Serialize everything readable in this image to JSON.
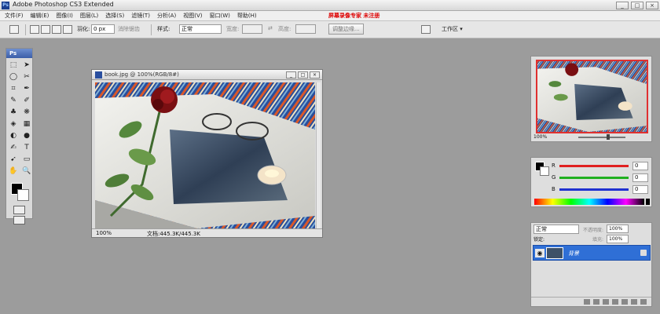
{
  "titlebar": {
    "app_icon": "Ps",
    "title": "Adobe Photoshop CS3 Extended",
    "min": "_",
    "max": "□",
    "close": "×"
  },
  "menubar": {
    "items": [
      "文件(F)",
      "编辑(E)",
      "图像(I)",
      "图层(L)",
      "选择(S)",
      "滤镜(T)",
      "分析(A)",
      "视图(V)",
      "窗口(W)",
      "帮助(H)"
    ],
    "watermark": "屏幕录像专家 未注册"
  },
  "options": {
    "feather_label": "羽化:",
    "feather_value": "0 px",
    "antialias": "消除锯齿",
    "style_label": "样式:",
    "style_value": "正常",
    "width_label": "宽度:",
    "height_label": "高度:",
    "refine_edge": "调整边缘...",
    "workspace": "工作区 ▾"
  },
  "toolbox": {
    "header": "Ps",
    "tools": [
      "⬚",
      "➤",
      "◯",
      "✂",
      "⌗",
      "✒",
      "✎",
      "✐",
      "♣",
      "❋",
      "◈",
      "▦",
      "◐",
      "●",
      "✍",
      "T",
      "➹",
      "▭",
      "✋",
      "🔍"
    ]
  },
  "document": {
    "title": "book.jpg @ 100%(RGB/8#)",
    "zoom": "100%",
    "doc_info": "文档:445.3K/445.3K"
  },
  "navigator": {
    "zoom": "100%"
  },
  "color_panel": {
    "rows": [
      {
        "label": "R",
        "value": "0",
        "color": "#e02020"
      },
      {
        "label": "G",
        "value": "0",
        "color": "#20b020"
      },
      {
        "label": "B",
        "value": "0",
        "color": "#2030d0"
      }
    ]
  },
  "layers": {
    "blend_mode": "正常",
    "opacity_label": "不透明度:",
    "opacity_value": "100%",
    "lock_label": "锁定:",
    "fill_label": "填充:",
    "fill_value": "100%",
    "layer_name": "背景"
  }
}
